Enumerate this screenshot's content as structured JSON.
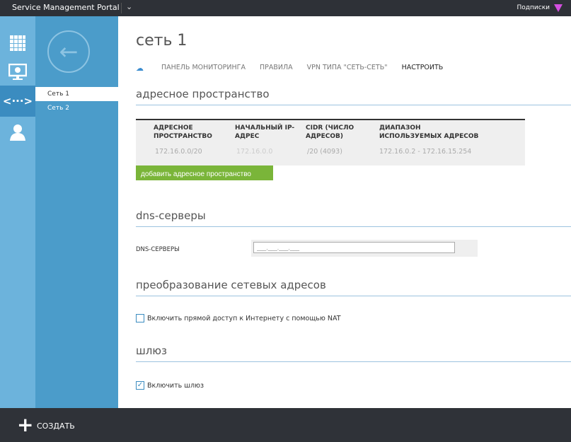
{
  "header": {
    "title": "Service Management Portal",
    "subscriptions": "Подписки",
    "filter_color": "#d44fe0"
  },
  "rail": {
    "icons": [
      "grid-icon",
      "virtual-machine-icon",
      "network-icon",
      "user-icon"
    ],
    "selected": "network-icon"
  },
  "nav": {
    "items": [
      {
        "label": "Сеть 1",
        "active": true
      },
      {
        "label": "Сеть 2",
        "active": false
      }
    ]
  },
  "page": {
    "title": "сеть 1",
    "tabs": [
      "ПАНЕЛЬ МОНИТОРИНГА",
      "ПРАВИЛА",
      "VPN ТИПА \"СЕТЬ-СЕТЬ\"",
      "НАСТРОИТЬ"
    ],
    "active_tab": "НАСТРОИТЬ"
  },
  "address_space": {
    "heading": "адресное пространство",
    "columns": [
      "АДРЕСНОЕ ПРОСТРАНСТВО",
      "НАЧАЛЬНЫЙ IP-АДРЕС",
      "CIDR (ЧИСЛО АДРЕСОВ)",
      "ДИАПАЗОН ИСПОЛЬЗУЕМЫХ АДРЕСОВ"
    ],
    "row": [
      "172.16.0.0/20",
      "172.16.0.0",
      "/20 (4093)",
      "172.16.0.2 - 172.16.15.254"
    ],
    "add_button": "добавить адресное пространство"
  },
  "dns": {
    "heading": "dns-серверы",
    "label": "DNS-СЕРВЕРЫ",
    "value": ""
  },
  "nat": {
    "heading": "преобразование сетевых адресов",
    "checkbox_label": "Включить прямой доступ к Интернету с помощью NAT",
    "checked": false
  },
  "gateway": {
    "heading": "шлюз",
    "checkbox_label": "Включить шлюз",
    "checked": true
  },
  "footer": {
    "create": "СОЗДАТЬ"
  },
  "colors": {
    "accent": "#4b9cca",
    "button": "#7ab539"
  }
}
